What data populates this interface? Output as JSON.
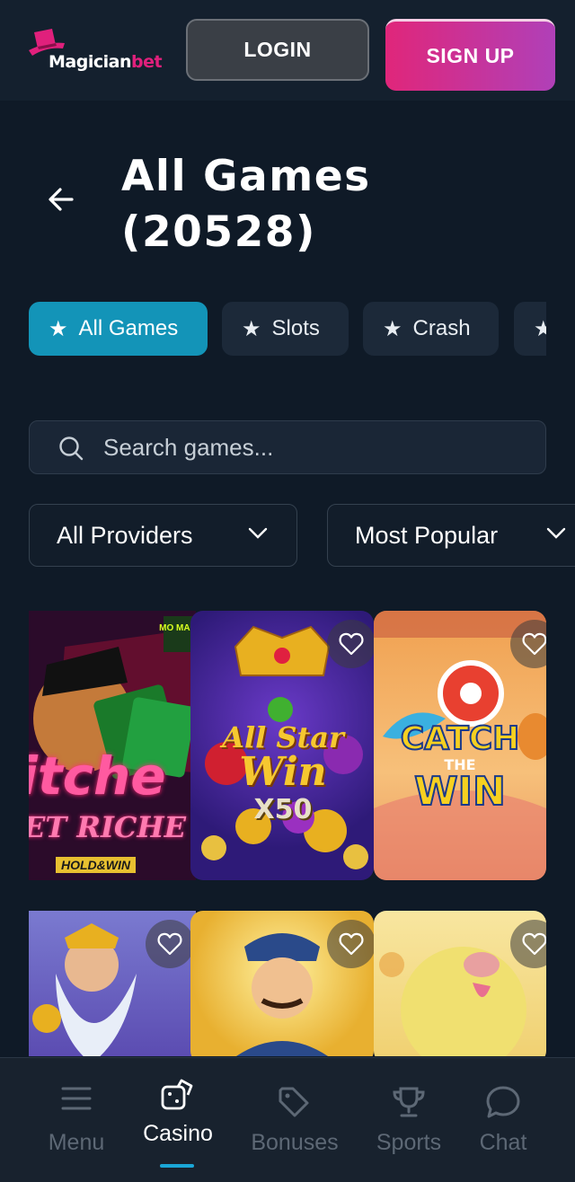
{
  "header": {
    "logo_text_white": "Magician",
    "logo_text_pink": "bet",
    "login_label": "LOGIN",
    "signup_label": "SIGN UP"
  },
  "page": {
    "title": "All Games (20528)"
  },
  "chips": [
    {
      "label": "All Games",
      "active": true
    },
    {
      "label": "Slots",
      "active": false
    },
    {
      "label": "Crash",
      "active": false
    }
  ],
  "search": {
    "placeholder": "Search games..."
  },
  "filters": {
    "provider": "All Providers",
    "sort": "Most Popular"
  },
  "games": [
    {
      "art_text": "itche",
      "art_text2": "ET RICHE",
      "art_text3": "HOLD&WIN",
      "badge": "MO MAD"
    },
    {
      "art_text": "All Star",
      "art_text2": "Win",
      "art_text3": "X50"
    },
    {
      "art_text": "CATCH",
      "art_text2": "THE",
      "art_text3": "WIN"
    },
    {},
    {},
    {}
  ],
  "bottom_nav": [
    {
      "label": "Menu",
      "icon": "menu-icon",
      "active": false
    },
    {
      "label": "Casino",
      "icon": "dice-icon",
      "active": true
    },
    {
      "label": "Bonuses",
      "icon": "tag-icon",
      "active": false
    },
    {
      "label": "Sports",
      "icon": "trophy-icon",
      "active": false
    },
    {
      "label": "Chat",
      "icon": "chat-icon",
      "active": false
    }
  ],
  "colors": {
    "background": "#0f1a27",
    "accent": "#1394b8",
    "brand_pink": "#e0207c"
  }
}
